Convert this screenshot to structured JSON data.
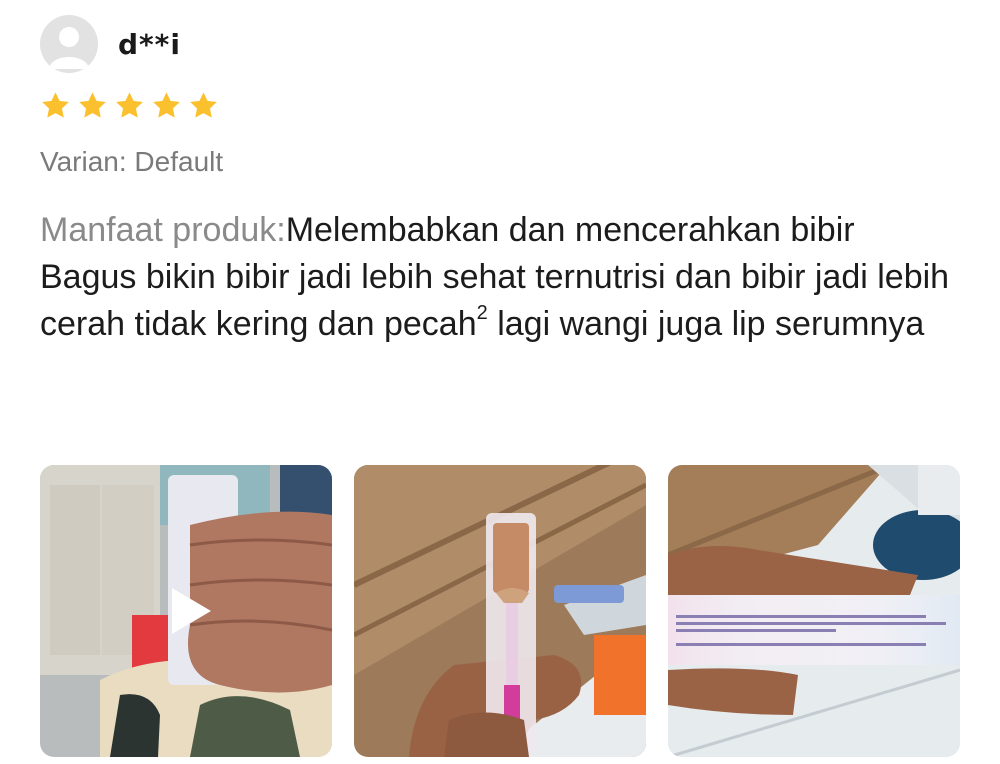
{
  "review": {
    "username": "d**i",
    "rating": 5,
    "rating_max": 5,
    "variant": "Varian: Default",
    "benefit_label": "Manfaat produk:",
    "benefit_text": "Melembabkan dan mencerahkan bibir",
    "comment_before_sup": "Bagus bikin bibir jadi lebih sehat ternutrisi dan bibir jadi lebih cerah tidak kering dan pecah",
    "comment_sup": "2",
    "comment_after_sup": " lagi wangi juga lip serumnya"
  },
  "media": [
    {
      "kind": "video",
      "icon": "play-icon"
    },
    {
      "kind": "photo"
    },
    {
      "kind": "photo"
    }
  ],
  "colors": {
    "star": "#fbc02d",
    "label_gray": "#8a8a8a",
    "text": "#1c1c1c"
  }
}
